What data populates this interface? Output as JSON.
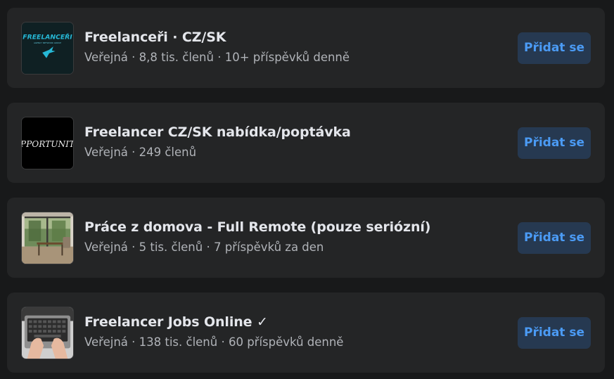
{
  "groups": [
    {
      "name": "Freelanceři · CZ/SK",
      "meta": "Veřejná · 8,8 tis. členů · 10+ příspěvků denně",
      "join_label": "Přidat se",
      "thumb_text": "FREELANCEŘI",
      "thumb_subtext": "AGENCY NETWORK GROUP",
      "thumb_accent": "#26b8d6"
    },
    {
      "name": "Freelancer CZ/SK nabídka/poptávka",
      "meta": "Veřejná · 249 členů",
      "join_label": "Přidat se",
      "thumb_text": "PPORTUNIT"
    },
    {
      "name": "Práce z domova - Full Remote (pouze seriózní)",
      "meta": "Veřejná · 5 tis. členů · 7 příspěvků za den",
      "join_label": "Přidat se"
    },
    {
      "name": "Freelancer Jobs Online ✓",
      "meta": "Veřejná · 138 tis. členů · 60 příspěvků denně",
      "join_label": "Přidat se"
    }
  ],
  "colors": {
    "page_background": "#18191a",
    "card_background": "#242526",
    "title_text": "#e4e6eb",
    "meta_text": "#b0b3b8",
    "join_button_background": "#263951",
    "join_button_text": "#4b9bf5"
  }
}
